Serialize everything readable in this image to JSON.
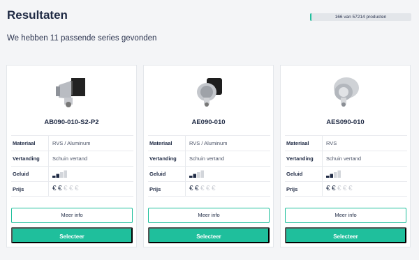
{
  "header": {
    "title": "Resultaten",
    "subtitle": "We hebben 11 passende series gevonden",
    "progress_label": "166 van 57214 producten",
    "progress_fraction": 0.0029
  },
  "labels": {
    "materiaal": "Materiaal",
    "vertanding": "Vertanding",
    "geluid": "Geluid",
    "prijs": "Prijs"
  },
  "buttons": {
    "info": "Meer info",
    "select": "Selecteer"
  },
  "products": [
    {
      "name": "AB090-010-S2-P2",
      "materiaal": "RVS / Aluminum",
      "vertanding": "Schuin vertand",
      "geluid_level": 2,
      "prijs_level": 2,
      "image_icon": "gearbox-flange-icon"
    },
    {
      "name": "AE090-010",
      "materiaal": "RVS / Aluminum",
      "vertanding": "Schuin vertand",
      "geluid_level": 2,
      "prijs_level": 2,
      "image_icon": "gearbox-round-icon"
    },
    {
      "name": "AES090-010",
      "materiaal": "RVS",
      "vertanding": "Schuin vertand",
      "geluid_level": 2,
      "prijs_level": 2,
      "image_icon": "gearbox-steel-icon"
    }
  ],
  "colors": {
    "accent": "#1fbf9c",
    "text": "#1f2a44",
    "muted": "#c9ccd3"
  }
}
